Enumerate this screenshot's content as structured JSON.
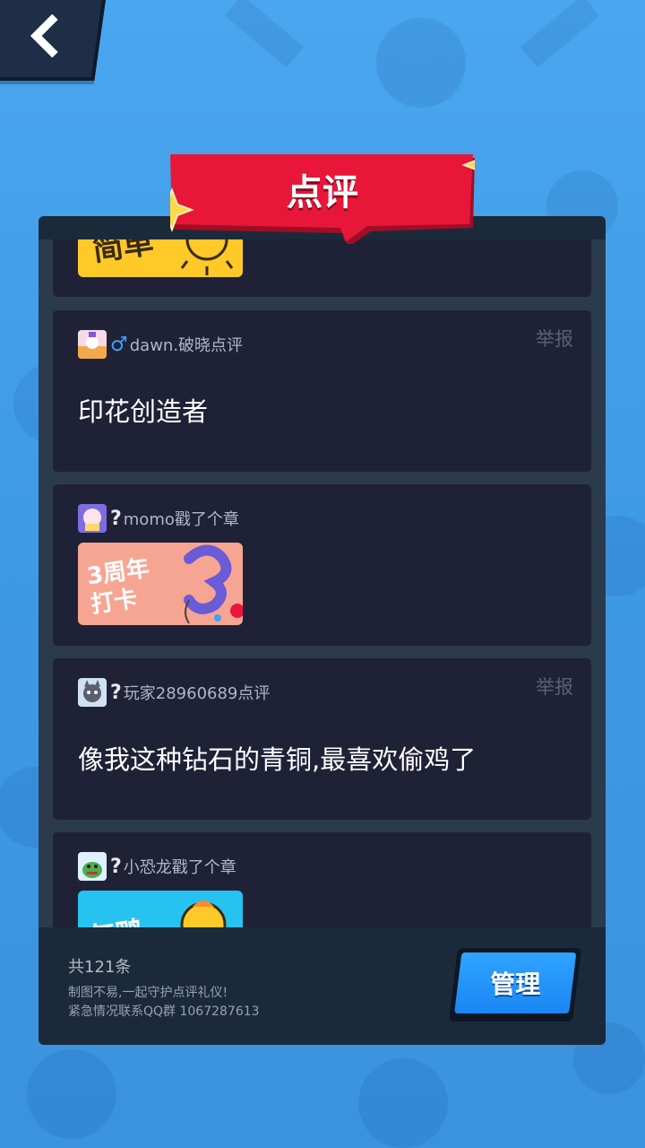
{
  "header": {
    "back_icon": "chevron-left-icon",
    "title": "点评"
  },
  "comments": [
    {
      "type": "sticker",
      "sticker_text": "简单"
    },
    {
      "type": "text",
      "gender": "♂",
      "username": "dawn.破晓点评",
      "report": "举报",
      "text": "印花创造者"
    },
    {
      "type": "sticker",
      "gender": "?",
      "username": "momo戳了个章",
      "sticker_text": "3周年打卡"
    },
    {
      "type": "text",
      "gender": "?",
      "username": "玩家28960689点评",
      "report": "举报",
      "text": "像我这种钻石的青铜,最喜欢偷鸡了"
    },
    {
      "type": "sticker",
      "gender": "?",
      "username": "小恐龙戳了个章",
      "sticker_text": "气鸭"
    }
  ],
  "footer": {
    "count": "共121条",
    "note1": "制图不易,一起守护点评礼仪!",
    "note2": "紧急情况联系QQ群 1067287613",
    "manage_label": "管理"
  },
  "colors": {
    "panel": "#2c3a4d",
    "card": "#1f2237",
    "accent_red": "#e8173a",
    "button_blue": "#1a86f3",
    "male_blue": "#3fa0ff"
  }
}
